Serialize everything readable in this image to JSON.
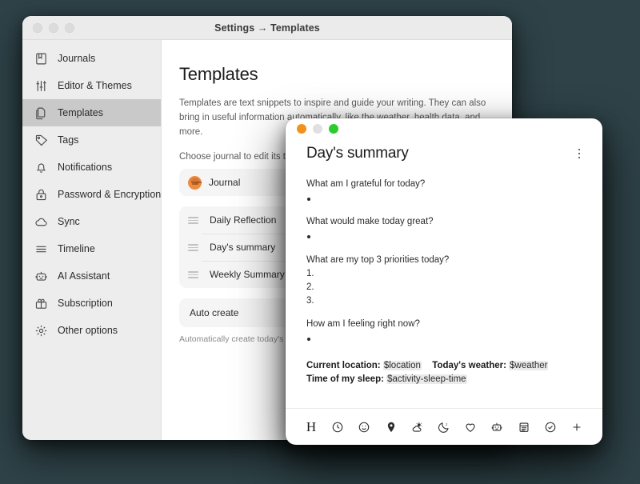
{
  "settings_window": {
    "title": "Settings → Templates",
    "traffic_lights": [
      "minimize",
      "zoom",
      "close"
    ],
    "sidebar": {
      "items": [
        {
          "label": "Journals",
          "icon": "book-icon",
          "selected": false
        },
        {
          "label": "Editor & Themes",
          "icon": "sliders-icon",
          "selected": false
        },
        {
          "label": "Templates",
          "icon": "copy-icon",
          "selected": true
        },
        {
          "label": "Tags",
          "icon": "tag-icon",
          "selected": false
        },
        {
          "label": "Notifications",
          "icon": "bell-icon",
          "selected": false
        },
        {
          "label": "Password & Encryption",
          "icon": "lock-icon",
          "selected": false
        },
        {
          "label": "Sync",
          "icon": "cloud-icon",
          "selected": false
        },
        {
          "label": "Timeline",
          "icon": "lines-icon",
          "selected": false
        },
        {
          "label": "AI Assistant",
          "icon": "robot-icon",
          "selected": false
        },
        {
          "label": "Subscription",
          "icon": "gift-icon",
          "selected": false
        },
        {
          "label": "Other options",
          "icon": "gear-icon",
          "selected": false
        }
      ]
    },
    "main": {
      "page_title": "Templates",
      "description": "Templates are text snippets to inspire and guide your writing. They can also bring in useful information automatically, like the weather, health data, and more.",
      "choose_label": "Choose journal to edit its templates",
      "journal": {
        "name": "Journal",
        "avatar_color": "#ef8b3c"
      },
      "templates": [
        {
          "name": "Daily Reflection"
        },
        {
          "name": "Day's summary"
        },
        {
          "name": "Weekly Summary"
        }
      ],
      "auto_create": {
        "label": "Auto create",
        "hint": "Automatically create today's entry"
      }
    }
  },
  "editor_window": {
    "title": "Day's summary",
    "traffic_lights": {
      "close": "#f2921d",
      "minimize": "#e0e0e0",
      "zoom": "#2dcc2d"
    },
    "more_menu": "more-options",
    "content": {
      "blocks": [
        {
          "question": "What am I grateful for today?",
          "list_type": "bullet",
          "items": [
            ""
          ]
        },
        {
          "question": "What would make today great?",
          "list_type": "bullet",
          "items": [
            ""
          ]
        },
        {
          "question": "What are my top 3 priorities today?",
          "list_type": "number",
          "items": [
            "1.",
            "2.",
            "3."
          ]
        },
        {
          "question": "How am I feeling right now?",
          "list_type": "bullet",
          "items": [
            ""
          ]
        }
      ],
      "variables": [
        {
          "label": "Current location:",
          "token": "$location",
          "label2": "Today's weather:",
          "token2": "$weather"
        },
        {
          "label": "Time of my sleep:",
          "token": "$activity-sleep-time"
        }
      ]
    },
    "toolbar": [
      {
        "icon": "heading-icon",
        "label": "H"
      },
      {
        "icon": "clock-icon"
      },
      {
        "icon": "smiley-icon"
      },
      {
        "icon": "location-pin-icon"
      },
      {
        "icon": "weather-icon"
      },
      {
        "icon": "sleep-moon-icon"
      },
      {
        "icon": "heart-icon"
      },
      {
        "icon": "robot-icon"
      },
      {
        "icon": "calendar-icon"
      },
      {
        "icon": "check-circle-icon"
      },
      {
        "icon": "plus-icon"
      }
    ]
  },
  "theme": {
    "background": "#2e4247",
    "accent_orange": "#ef8b3c",
    "selected_row": "#c9c9c9"
  }
}
